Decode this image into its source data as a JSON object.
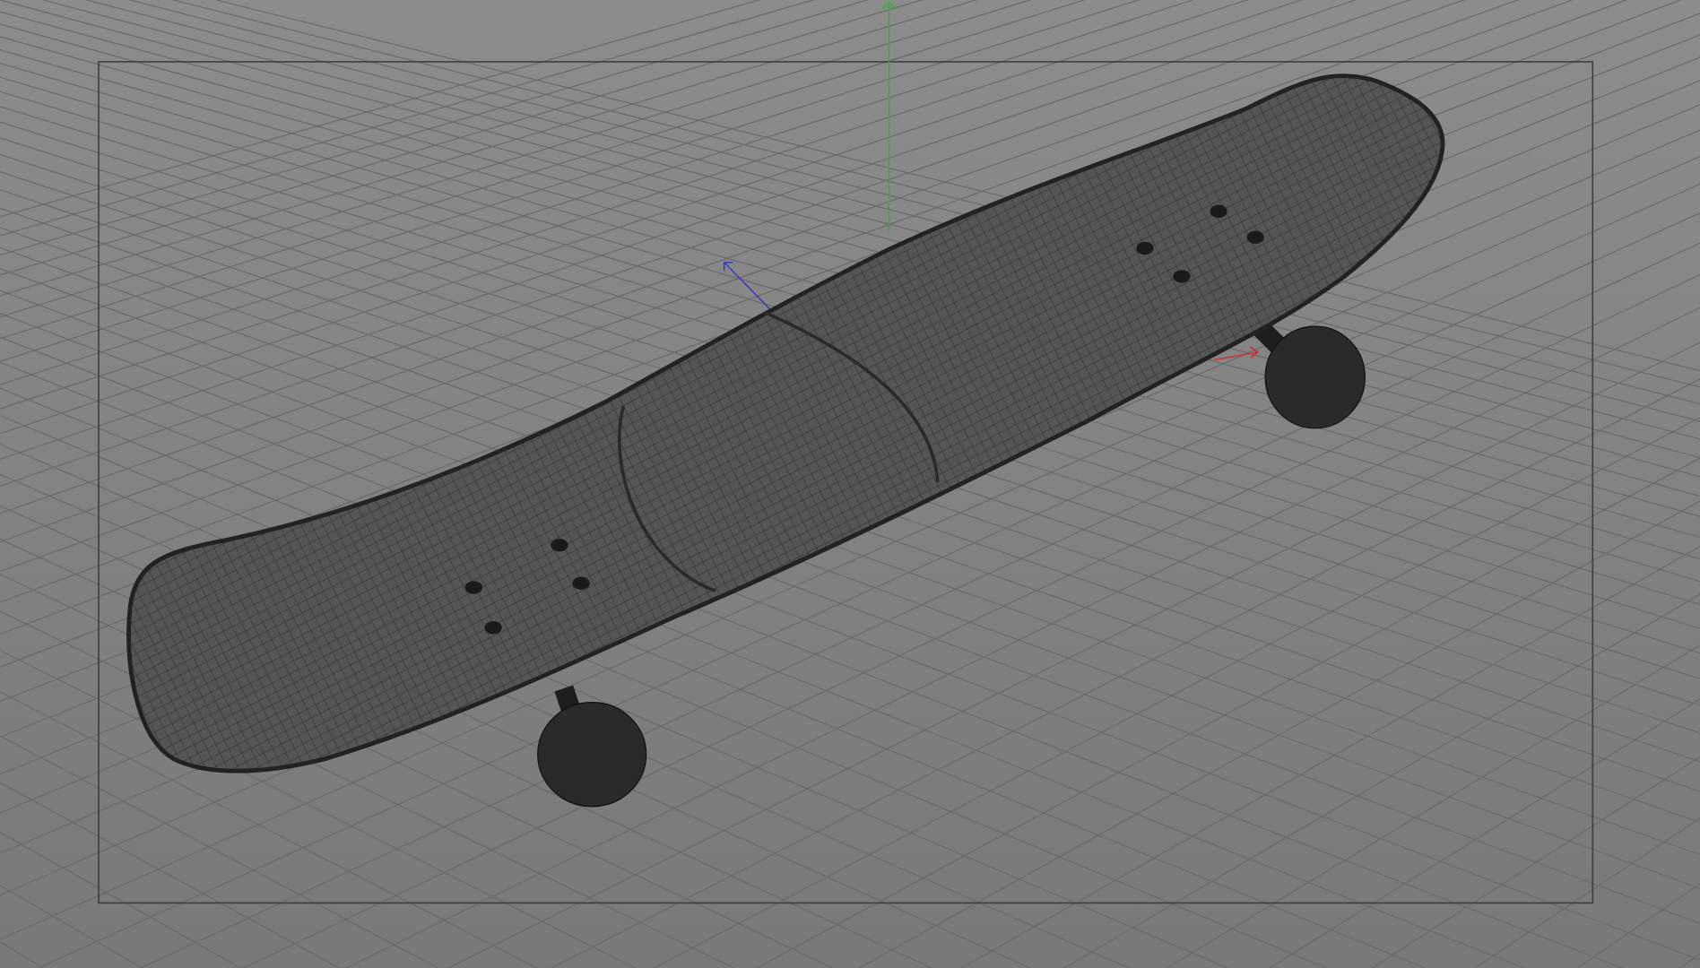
{
  "viewport": {
    "grid": true,
    "safe_frame": true,
    "axis_gizmo": true
  }
}
